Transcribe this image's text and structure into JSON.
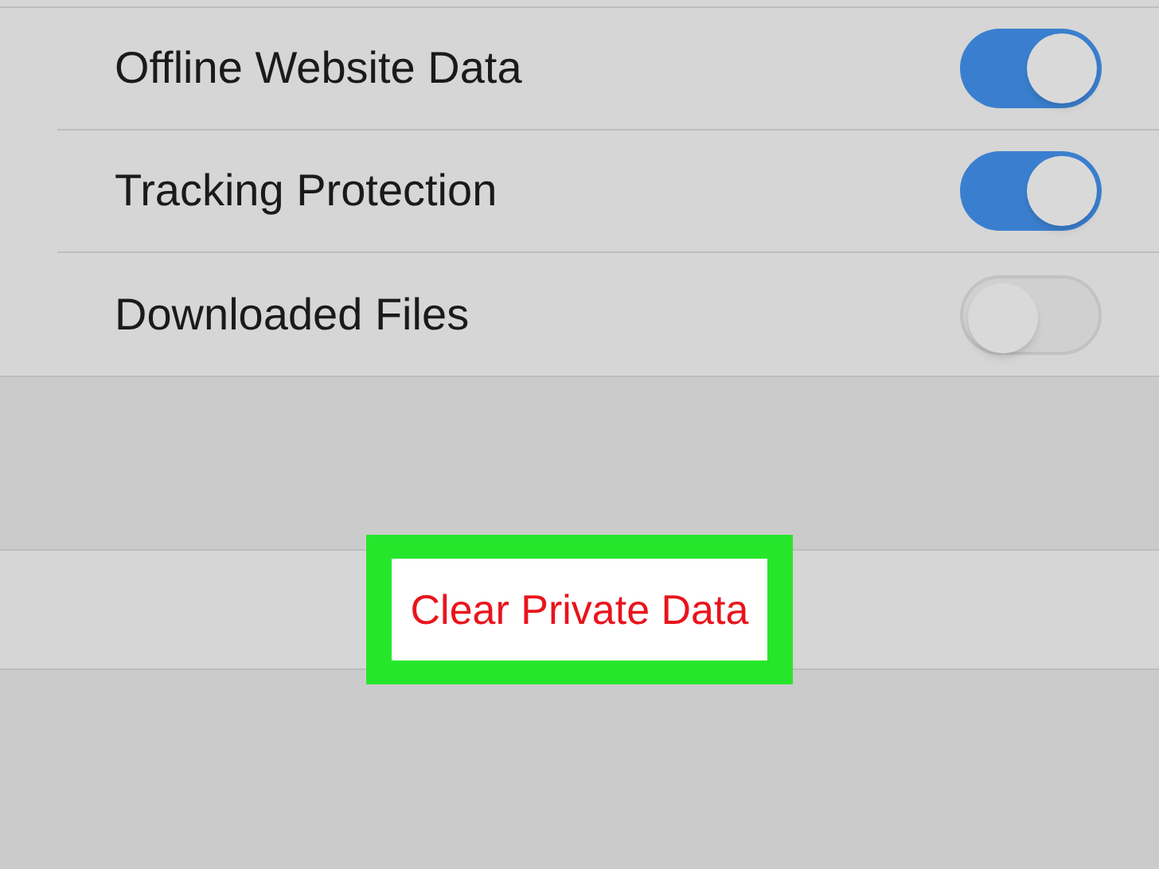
{
  "settings": [
    {
      "label": "Offline Website Data",
      "on": true
    },
    {
      "label": "Tracking Protection",
      "on": true
    },
    {
      "label": "Downloaded Files",
      "on": false
    }
  ],
  "action": {
    "label": "Clear Private Data",
    "highlighted": true
  }
}
